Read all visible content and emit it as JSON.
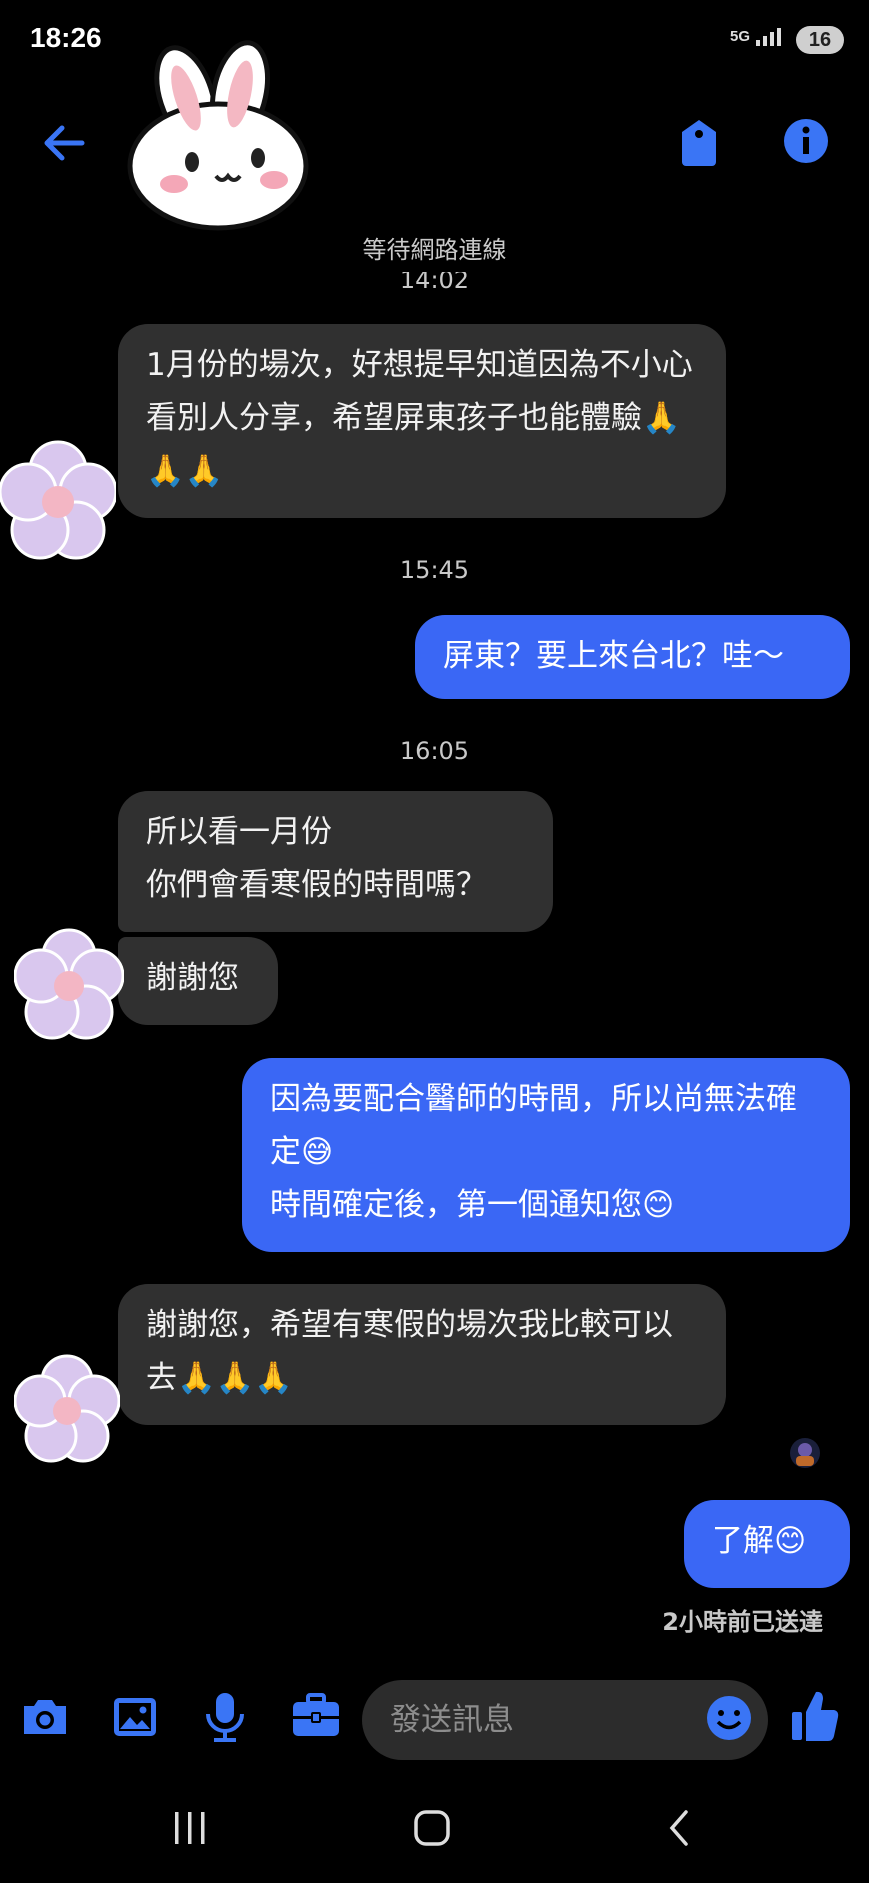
{
  "status_bar": {
    "time": "18:26",
    "network": "5G",
    "battery": "16"
  },
  "header": {
    "connection_status": "等待網路連線"
  },
  "messages": [
    {
      "kind": "timestamp",
      "text": "14:02"
    },
    {
      "kind": "incoming",
      "text": "1月份的場次，好想提早知道因為不小心看別人分享，希望屏東孩子也能體驗🙏🙏🙏"
    },
    {
      "kind": "timestamp",
      "text": "15:45"
    },
    {
      "kind": "outgoing",
      "text": "屏東？要上來台北？哇～"
    },
    {
      "kind": "timestamp",
      "text": "16:05"
    },
    {
      "kind": "incoming",
      "text": "所以看一月份\n你們會看寒假的時間嗎？"
    },
    {
      "kind": "incoming",
      "text": "謝謝您"
    },
    {
      "kind": "outgoing",
      "text": "因為要配合醫師的時間，所以尚無法確定😅\n時間確定後，第一個通知您😊"
    },
    {
      "kind": "incoming",
      "text": "謝謝您，希望有寒假的場次我比較可以去🙏🙏🙏"
    },
    {
      "kind": "outgoing",
      "text": "了解😊"
    }
  ],
  "delivery_status": "2小時前已送達",
  "composer": {
    "placeholder": "發送訊息"
  },
  "colors": {
    "accent": "#3a67f5",
    "incoming_bubble": "#303030",
    "background": "#000000"
  },
  "icons": [
    "back-arrow-icon",
    "tag-icon",
    "info-icon",
    "camera-icon",
    "image-icon",
    "microphone-icon",
    "briefcase-icon",
    "emoji-icon",
    "thumbs-up-icon",
    "recents-icon",
    "home-icon",
    "nav-back-icon"
  ]
}
